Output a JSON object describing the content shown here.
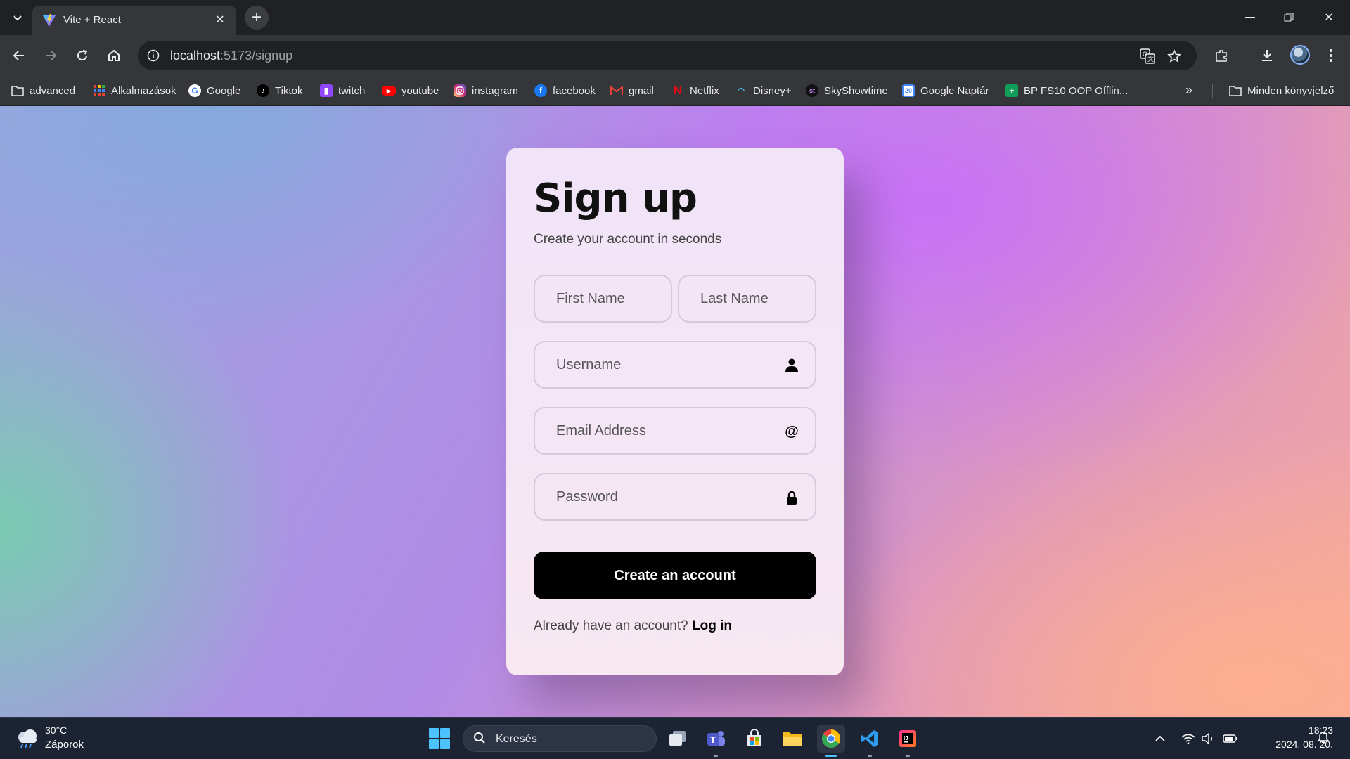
{
  "browser": {
    "tab": {
      "title": "Vite + React"
    },
    "url": {
      "host": "localhost",
      "path": ":5173/signup"
    },
    "bookmarks": [
      {
        "label": "advanced",
        "icon": "folder-icon"
      },
      {
        "label": "Alkalmazások",
        "icon": "apps-grid-icon"
      },
      {
        "label": "Google",
        "icon": "google-icon"
      },
      {
        "label": "Tiktok",
        "icon": "tiktok-icon"
      },
      {
        "label": "twitch",
        "icon": "twitch-icon"
      },
      {
        "label": "youtube",
        "icon": "youtube-icon"
      },
      {
        "label": "instagram",
        "icon": "instagram-icon"
      },
      {
        "label": "facebook",
        "icon": "facebook-icon"
      },
      {
        "label": "gmail",
        "icon": "gmail-icon"
      },
      {
        "label": "Netflix",
        "icon": "netflix-icon"
      },
      {
        "label": "Disney+",
        "icon": "disney-icon"
      },
      {
        "label": "SkyShowtime",
        "icon": "skyshowtime-icon"
      },
      {
        "label": "Google Naptár",
        "icon": "calendar-icon"
      },
      {
        "label": "BP FS10 OOP Offlin...",
        "icon": "sheets-icon"
      }
    ],
    "all_bookmarks": "Minden könyvjelző"
  },
  "signup": {
    "title": "Sign up",
    "subtitle": "Create your account in seconds",
    "first_name_placeholder": "First Name",
    "last_name_placeholder": "Last Name",
    "username_placeholder": "Username",
    "email_placeholder": "Email Address",
    "password_placeholder": "Password",
    "submit_label": "Create an account",
    "login_prompt": "Already have an account?",
    "login_link": "Log in"
  },
  "taskbar": {
    "weather_temp": "30°C",
    "weather_desc": "Záporok",
    "search_label": "Keresés",
    "time": "18:23",
    "date": "2024. 08. 20."
  },
  "colors": {
    "button": "#000000",
    "card": "#f3e6f6",
    "accent": "#4cc2ff"
  }
}
